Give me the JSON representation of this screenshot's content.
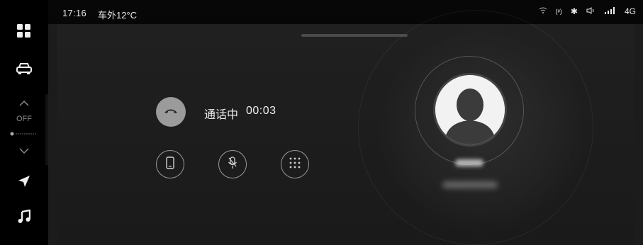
{
  "status": {
    "time": "17:16",
    "temperature": "车外12°C",
    "network": "4G"
  },
  "dock": {
    "climate_status": "OFF"
  },
  "call": {
    "state": "通话中",
    "duration": "00:03"
  },
  "colors": {
    "background": "#0b0b0b",
    "panel": "#1c1c1c",
    "accent_button": "#9b9b9b"
  },
  "icons": [
    "apps-grid-icon",
    "car-icon",
    "chevron-up-icon",
    "fan-icon",
    "chevron-down-icon",
    "navigation-icon",
    "music-icon",
    "wifi-icon",
    "hotspot-icon",
    "bluetooth-icon",
    "volume-icon",
    "signal-icon",
    "hang-up-icon",
    "phone-handset-icon",
    "mic-mute-icon",
    "keypad-icon"
  ]
}
